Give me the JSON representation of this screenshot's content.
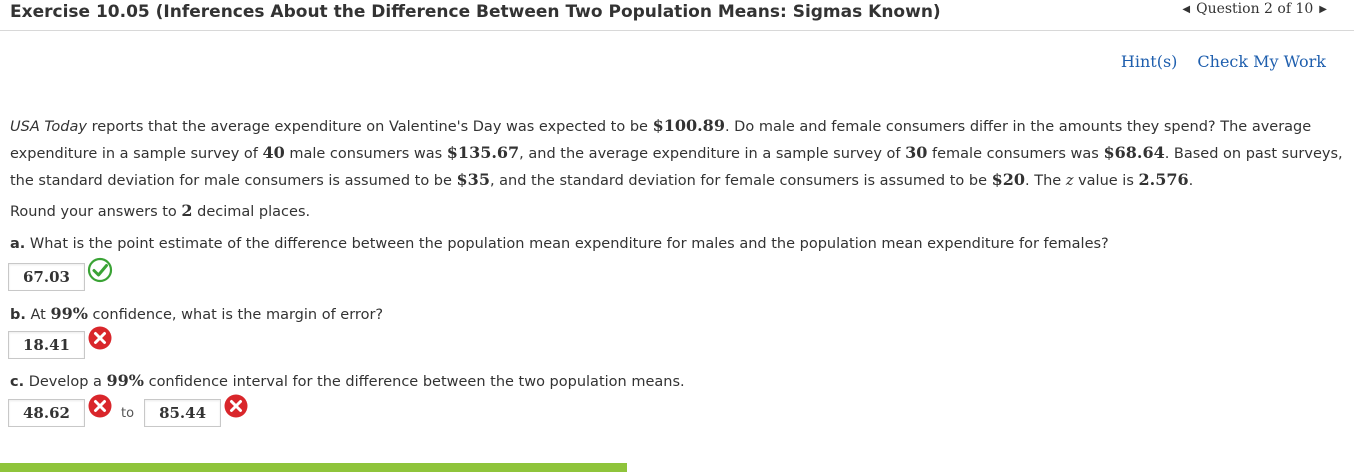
{
  "header": {
    "title": "Exercise 10.05 (Inferences About the Difference Between Two Population Means: Sigmas Known)",
    "question_position": "Question 2 of 10"
  },
  "links": {
    "hints": "Hint(s)",
    "check": "Check My Work"
  },
  "problem": {
    "source": "USA Today",
    "s1": " reports that the average expenditure on Valentine's Day was expected to be ",
    "v1": "$100.89",
    "s2": ". Do male and female consumers differ in the amounts they spend? The average expenditure in a sample survey of ",
    "v2": "40",
    "s3": " male consumers was ",
    "v3": "$135.67",
    "s4": ", and the average expenditure in a sample survey of ",
    "v4": "30",
    "s5": " female consumers was ",
    "v5": "$68.64",
    "s6": ". Based on past surveys, the standard deviation for male consumers is assumed to be ",
    "v6": "$35",
    "s7": ", and the standard deviation for female consumers is assumed to be ",
    "v7": "$20",
    "s8": ". The ",
    "zsym": "z",
    "s9": " value is ",
    "v8": "2.576",
    "s10": "."
  },
  "round": {
    "pre": "Round your answers to ",
    "num": "2",
    "post": " decimal places."
  },
  "qa": {
    "letter": "a.",
    "text": " What is the point estimate of the difference between the population mean expenditure for males and the population mean expenditure for females?",
    "answer": "67.03",
    "status": "correct"
  },
  "qb": {
    "letter": "b.",
    "pre": " At ",
    "pct": "99%",
    "post": " confidence, what is the margin of error?",
    "answer": "18.41",
    "status": "incorrect"
  },
  "qc": {
    "letter": "c.",
    "pre": " Develop a ",
    "pct": "99%",
    "post": " confidence interval for the difference between the two population means.",
    "lower": "48.62",
    "lower_status": "incorrect",
    "to": "to",
    "upper": "85.44",
    "upper_status": "incorrect"
  },
  "colors": {
    "link": "#1f5fae",
    "correct": "#3aa335",
    "incorrect": "#d9262b",
    "progress": "#8fc43b"
  },
  "progress": {
    "fraction": 0.46
  }
}
